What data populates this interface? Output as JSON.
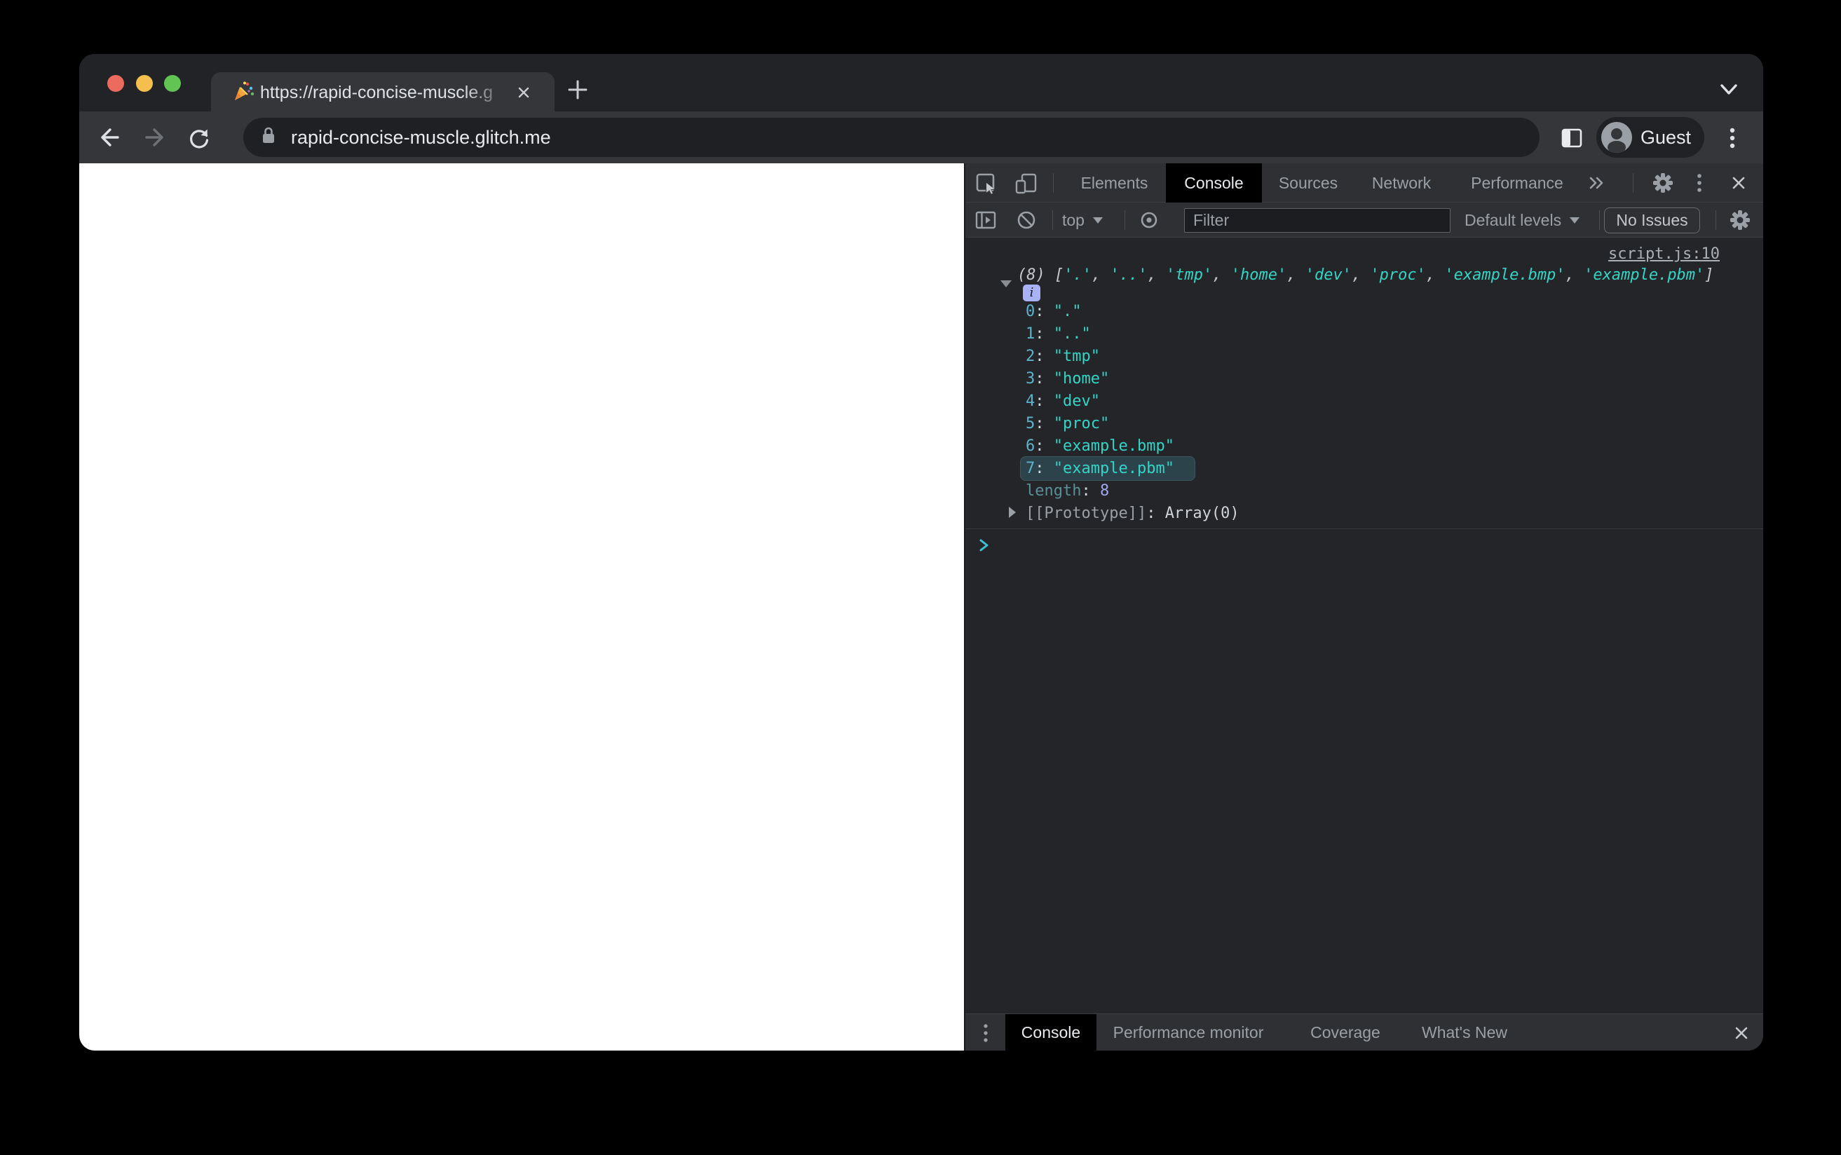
{
  "browser": {
    "tab": {
      "title": "https://rapid-concise-muscle.g",
      "favicon": "party-popper"
    },
    "address_bar": {
      "url": "rapid-concise-muscle.glitch.me"
    },
    "profile": {
      "label": "Guest"
    }
  },
  "devtools": {
    "main_tabs": {
      "elements": "Elements",
      "console": "Console",
      "sources": "Sources",
      "network": "Network",
      "performance": "Performance"
    },
    "selected_tab": "Console",
    "filter_bar": {
      "context": "top",
      "filter_placeholder": "Filter",
      "levels": "Default levels",
      "issues_label": "No Issues"
    },
    "console": {
      "source_link": "script.js:10",
      "info_badge": "i",
      "preview": {
        "count": "(8)",
        "open": "[",
        "close": "]",
        "separator": ", ",
        "items": [
          "'.'",
          "'..'",
          "'tmp'",
          "'home'",
          "'dev'",
          "'proc'",
          "'example.bmp'",
          "'example.pbm'"
        ]
      },
      "colon": ": ",
      "entries": [
        {
          "key": "0",
          "value": "\".\""
        },
        {
          "key": "1",
          "value": "\"..\""
        },
        {
          "key": "2",
          "value": "\"tmp\""
        },
        {
          "key": "3",
          "value": "\"home\""
        },
        {
          "key": "4",
          "value": "\"dev\""
        },
        {
          "key": "5",
          "value": "\"proc\""
        },
        {
          "key": "6",
          "value": "\"example.bmp\""
        },
        {
          "key": "7",
          "value": "\"example.pbm\""
        }
      ],
      "highlighted_entry": "7",
      "length_key": "length",
      "length_value": "8",
      "prototype_key": "[[Prototype]]",
      "prototype_value": "Array(0)",
      "prompt": ">"
    },
    "drawer": {
      "tabs": {
        "console": "Console",
        "performance_monitor": "Performance monitor",
        "coverage": "Coverage",
        "whats_new": "What's New"
      },
      "selected": "Console"
    }
  },
  "colors": {
    "string": "#35d4c7",
    "array_index": "#5db3cc",
    "number": "#a2a7f0",
    "muted_property": "#5a8f97",
    "link": "#aab0b6",
    "row_highlight_bg": "#2d434c",
    "info_badge_bg": "#a9b2f4",
    "prompt": "#3dc0d3",
    "devtools_toolbar_bg": "#2f3034",
    "console_bg": "#242528",
    "selected_tab_bg": "#000000",
    "chrome_frame_bg": "#222327",
    "chrome_toolbar_bg": "#35363a",
    "url_pill_bg": "#1f2023"
  }
}
